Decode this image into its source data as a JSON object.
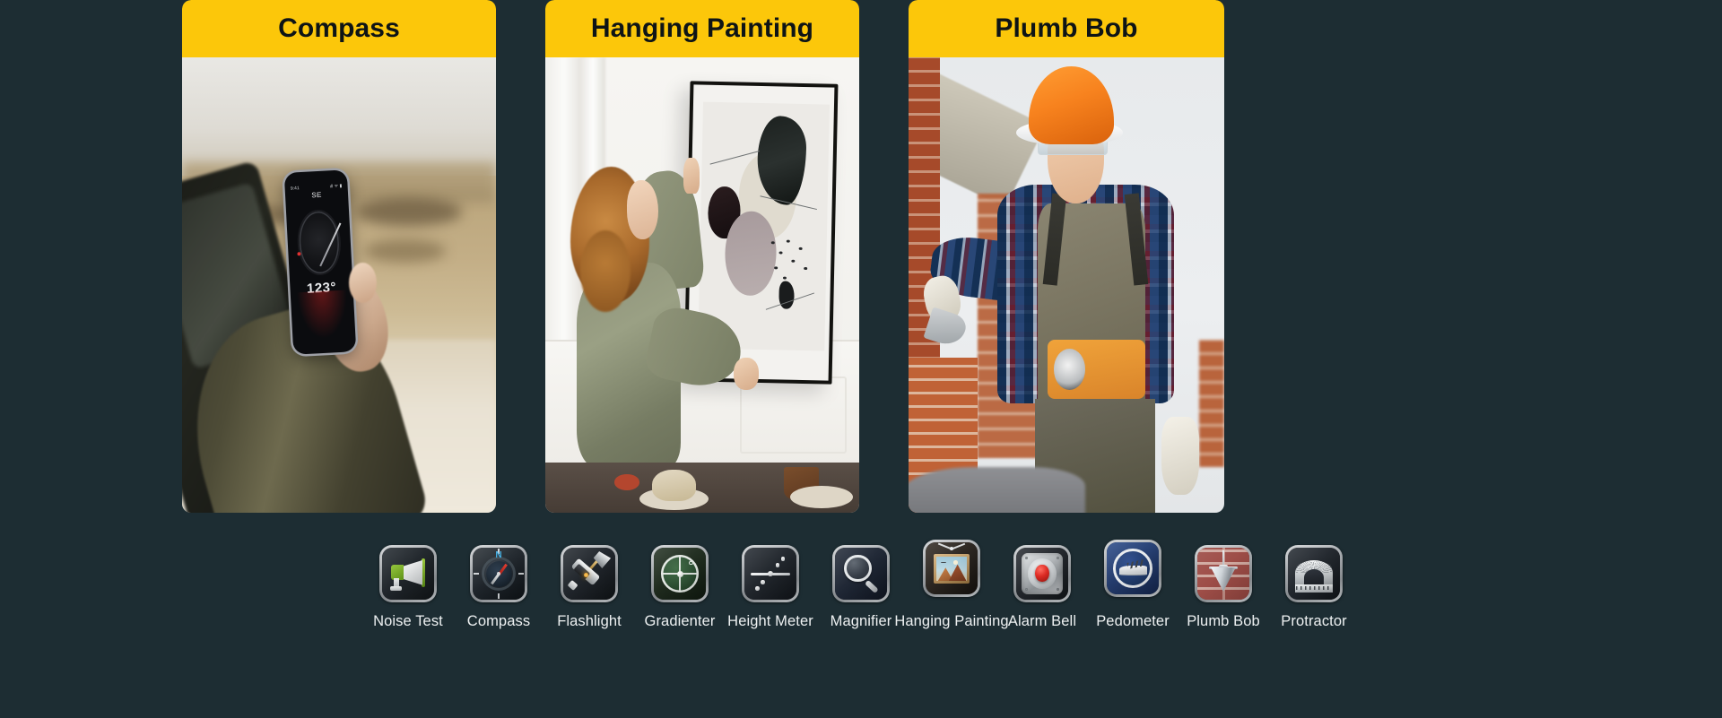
{
  "page": {
    "background_color": "#1d2d33",
    "accent_color": "#FCC70A",
    "label_color": "#eef1f2"
  },
  "cards": [
    {
      "title": "Compass",
      "photo_alt": "Person leaning out of a car window in a desert holding a phone showing a compass app",
      "phone_screen": {
        "direction": "SE",
        "degrees": "123°",
        "status_left": "9:41",
        "status_right": "ıll ᯤ ▮"
      }
    },
    {
      "title": "Hanging Painting",
      "photo_alt": "Woman in olive shirt hanging a large framed abstract painting on a white wall"
    },
    {
      "title": "Plumb Bob",
      "photo_alt": "Construction worker in orange hard hat laying bricks with a trowel"
    }
  ],
  "icon_row": [
    {
      "label": "Noise Test",
      "icon": "megaphone-icon"
    },
    {
      "label": "Compass",
      "icon": "compass-icon"
    },
    {
      "label": "Flashlight",
      "icon": "flashlight-icon"
    },
    {
      "label": "Gradienter",
      "icon": "level-bubble-icon"
    },
    {
      "label": "Height Meter",
      "icon": "height-meter-icon"
    },
    {
      "label": "Magnifier",
      "icon": "magnifying-glass-icon"
    },
    {
      "label": "Hanging Painting",
      "icon": "framed-picture-icon"
    },
    {
      "label": "Alarm Bell",
      "icon": "alarm-button-icon"
    },
    {
      "label": "Pedometer",
      "icon": "sneaker-icon"
    },
    {
      "label": "Plumb Bob",
      "icon": "plumb-bob-icon"
    },
    {
      "label": "Protractor",
      "icon": "protractor-icon"
    }
  ]
}
